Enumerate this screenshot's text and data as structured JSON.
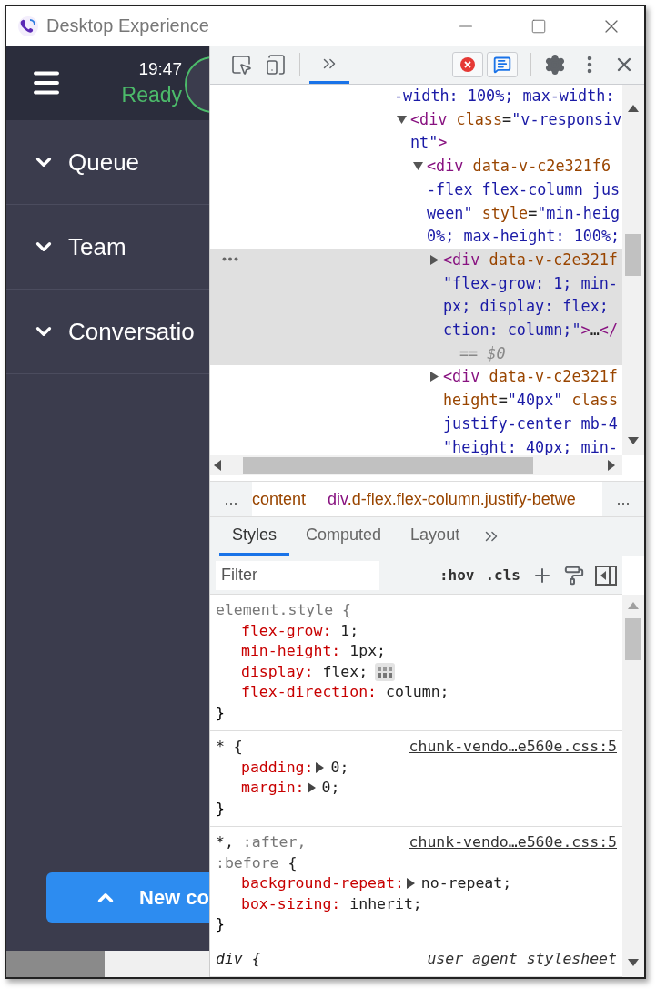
{
  "window": {
    "title": "Desktop Experience"
  },
  "app": {
    "time": "19:47",
    "status": "Ready",
    "nav_items": [
      {
        "label": "Queue"
      },
      {
        "label": "Team"
      },
      {
        "label": "Conversatio"
      }
    ],
    "new_button": {
      "label": "New co"
    }
  },
  "devtools": {
    "toolbar_tabs": [
      {
        "kind": "more",
        "selected": true
      }
    ],
    "elements": {
      "partial_line": [
        {
          "kind": "value",
          "t": "-width: 100%; max-width:"
        }
      ],
      "nodes": [
        {
          "expanded": true,
          "selected": false,
          "lines": [
            [
              {
                "kind": "tag",
                "t": "<div "
              },
              {
                "kind": "attr",
                "t": "class"
              },
              {
                "kind": "text",
                "t": "="
              },
              {
                "kind": "value",
                "t": "\"v-responsiv"
              }
            ],
            [
              {
                "kind": "value",
                "t": "nt\""
              },
              {
                "kind": "tag",
                "t": ">"
              }
            ]
          ],
          "children": [
            {
              "expanded": true,
              "selected": false,
              "lines": [
                [
                  {
                    "kind": "tag",
                    "t": "<div "
                  },
                  {
                    "kind": "attr",
                    "t": "data-v-c2e321f6"
                  }
                ],
                [
                  {
                    "kind": "value",
                    "t": "-flex flex-column jus"
                  }
                ],
                [
                  {
                    "kind": "value",
                    "t": "ween\" "
                  },
                  {
                    "kind": "attr",
                    "t": "style"
                  },
                  {
                    "kind": "text",
                    "t": "="
                  },
                  {
                    "kind": "value",
                    "t": "\"min-heig"
                  }
                ],
                [
                  {
                    "kind": "value",
                    "t": "0%; max-height: 100%;"
                  }
                ]
              ],
              "children": [
                {
                  "expanded": false,
                  "selected": true,
                  "console_ref": "== $0",
                  "lines": [
                    [
                      {
                        "kind": "tag",
                        "t": "<div "
                      },
                      {
                        "kind": "attr",
                        "t": "data-v-c2e321f"
                      }
                    ],
                    [
                      {
                        "kind": "value",
                        "t": "\"flex-grow: 1; min-"
                      }
                    ],
                    [
                      {
                        "kind": "value",
                        "t": "px; display: flex;"
                      }
                    ],
                    [
                      {
                        "kind": "value",
                        "t": "ction: column;\""
                      },
                      {
                        "kind": "tag",
                        "t": ">"
                      },
                      {
                        "kind": "text",
                        "t": "…"
                      },
                      {
                        "kind": "tag",
                        "t": "</"
                      }
                    ]
                  ]
                },
                {
                  "expanded": false,
                  "selected": false,
                  "lines": [
                    [
                      {
                        "kind": "tag",
                        "t": "<div "
                      },
                      {
                        "kind": "attr",
                        "t": "data-v-c2e321f"
                      }
                    ],
                    [
                      {
                        "kind": "attr",
                        "t": "height"
                      },
                      {
                        "kind": "text",
                        "t": "="
                      },
                      {
                        "kind": "value",
                        "t": "\"40px\" "
                      },
                      {
                        "kind": "attr",
                        "t": "class"
                      }
                    ],
                    [
                      {
                        "kind": "value",
                        "t": "justify-center mb-4"
                      }
                    ],
                    [
                      {
                        "kind": "value",
                        "t": "\"height: 40px; min-"
                      }
                    ]
                  ]
                }
              ]
            }
          ]
        }
      ]
    },
    "breadcrumbs": [
      {
        "ellipsis": "...",
        "items": [
          [
            {
              "kind": "attr",
              "t": "content"
            }
          ],
          [
            {
              "kind": "tag",
              "t": "div"
            },
            {
              "kind": "attr",
              "t": ".d-flex.flex-column.justify-betwe"
            }
          ]
        ],
        "trailing": "..."
      }
    ],
    "tabs": [
      {
        "label": "Styles",
        "selected": true
      },
      {
        "label": "Computed",
        "selected": false
      },
      {
        "label": "Layout",
        "selected": false
      }
    ],
    "filter": {
      "placeholder": "Filter"
    },
    "filter_buttons": [
      ":hov",
      ".cls"
    ],
    "rules": [
      {
        "selector_lines": [
          [
            {
              "kind": "sel",
              "t": "element.style {"
            }
          ]
        ],
        "properties": [
          {
            "name": "flex-grow:",
            "value": "1;",
            "expandable": false,
            "grid_badge": false
          },
          {
            "name": "min-height:",
            "value": "1px;",
            "expandable": false,
            "grid_badge": false
          },
          {
            "name": "display:",
            "value": "flex;",
            "expandable": false,
            "grid_badge": true
          },
          {
            "name": "flex-direction:",
            "value": "column;",
            "expandable": false,
            "grid_badge": false
          }
        ],
        "closing": "}"
      },
      {
        "selector_lines": [
          [
            {
              "kind": "text",
              "t": "* {"
            }
          ]
        ],
        "source": "chunk-vendo…e560e.css:5",
        "kind": "link",
        "properties": [
          {
            "name": "padding:",
            "value": "0;",
            "expandable": true,
            "grid_badge": false
          },
          {
            "name": "margin:",
            "value": "0;",
            "expandable": true,
            "grid_badge": false
          }
        ],
        "closing": "}"
      },
      {
        "selector_lines": [
          [
            {
              "kind": "text",
              "t": "*, "
            },
            {
              "kind": "sel",
              "t": ":after,"
            }
          ],
          [
            {
              "kind": "sel",
              "t": ":before"
            },
            {
              "kind": "text",
              "t": " {"
            }
          ]
        ],
        "source": "chunk-vendo…e560e.css:5",
        "kind": "link",
        "properties": [
          {
            "name": "background-repeat:",
            "value": "no-repeat;",
            "expandable": true,
            "grid_badge": false
          },
          {
            "name": "box-sizing:",
            "value": "inherit;",
            "expandable": false,
            "grid_badge": false
          }
        ],
        "closing": "}"
      },
      {
        "selector_lines": [
          [
            {
              "kind": "italic",
              "t": "div {"
            }
          ]
        ],
        "source": "user agent stylesheet",
        "kind": "agent"
      }
    ]
  }
}
